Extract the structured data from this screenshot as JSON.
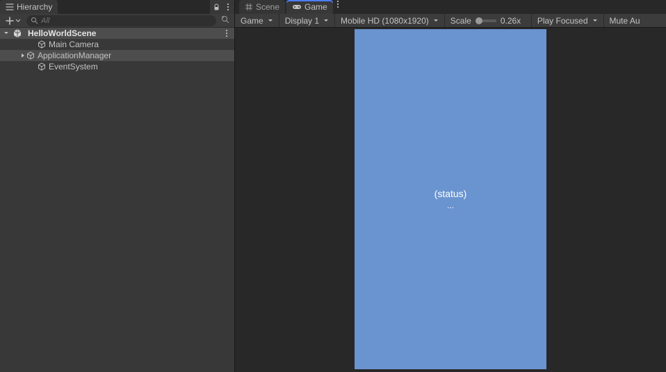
{
  "hierarchy": {
    "tab_label": "Hierarchy",
    "search_placeholder": "All",
    "scene": "HelloWorldScene",
    "items": [
      {
        "label": "Main Camera",
        "expandable": false,
        "selected": false
      },
      {
        "label": "ApplicationManager",
        "expandable": true,
        "selected": true
      },
      {
        "label": "EventSystem",
        "expandable": false,
        "selected": false
      }
    ]
  },
  "right": {
    "tabs": {
      "scene": "Scene",
      "game": "Game"
    },
    "toolbar": {
      "mode": "Game",
      "display": "Display 1",
      "resolution": "Mobile HD (1080x1920)",
      "scale_label": "Scale",
      "scale_value": "0.26x",
      "play_mode": "Play Focused",
      "mute": "Mute Au"
    },
    "viewport": {
      "status": "(status)",
      "sub": "..."
    }
  }
}
